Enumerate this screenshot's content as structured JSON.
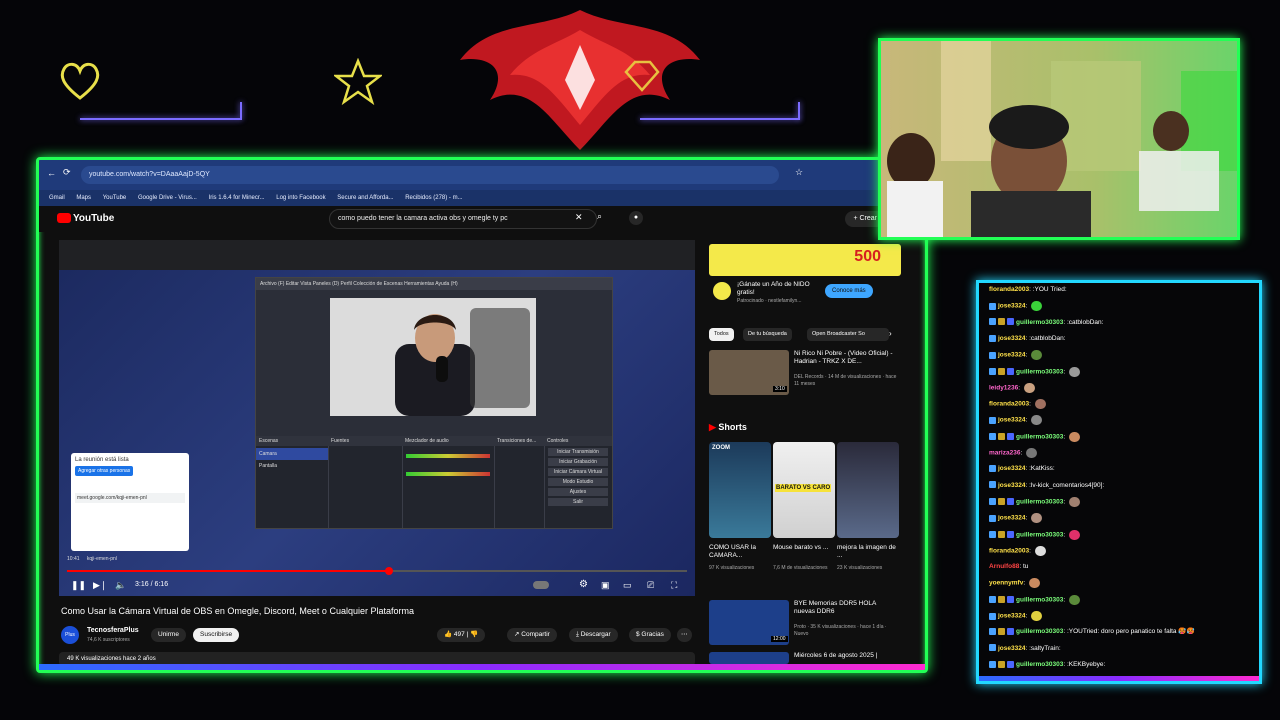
{
  "browser": {
    "url": "youtube.com/watch?v=DAaaAajD-5QY",
    "bookmarks": [
      "Gmail",
      "Maps",
      "YouTube",
      "Google Drive - Virus...",
      "Iris 1.6.4 for Minecr...",
      "Log into Facebook",
      "Secure and Afforda...",
      "Recibidos (278) - m..."
    ]
  },
  "youtube": {
    "logo": "YouTube",
    "search_query": "como puedo tener la camara activa obs y omegle ty pc",
    "create_label": "Crear",
    "video": {
      "time_current": "3:16",
      "time_total": "6:16",
      "progress": 0.52,
      "inner_clock": "10:41",
      "inner_meet_code": "kqji-emen-pnl",
      "meet_card_title": "La reunión está lista",
      "meet_card_button": "Agregar otras personas",
      "meet_card_link": "meet.google.com/kqji-emen-pnl",
      "obs_menu": "Archivo (F)   Editar   Vista   Paneles (D)   Perfil   Colección de Escenas   Herramientas   Ayuda (H)",
      "obs_docks": [
        "Escenas",
        "Fuentes",
        "Mezclador de audio",
        "Transiciones de...",
        "Controles"
      ],
      "obs_scenes": [
        "Camara",
        "Pantalla"
      ],
      "obs_controls": [
        "Iniciar Transmisión",
        "Iniciar Grabación",
        "Iniciar Cámara Virtual",
        "Modo Estudio",
        "Ajustes",
        "Salir"
      ]
    },
    "title": "Como Usar la Cámara Virtual de OBS en Omegle, Discord, Meet o Cualquier Plataforma",
    "channel_name": "TecnosferaPlus",
    "channel_avatar_text": "Plus",
    "channel_subs": "74,6 K suscriptores",
    "join_label": "Unirme",
    "subscribe_label": "Suscribirse",
    "likes": "497",
    "share_label": "Compartir",
    "download_label": "Descargar",
    "thanks_label": "Gracias",
    "desc_meta": "49 K visualizaciones  hace 2 años",
    "ad": {
      "number": "500",
      "title": "¡Gánate un Año de NIDO gratis!",
      "sponsored": "Patrocinado · nestlefamilyn...",
      "button": "Conoce más"
    },
    "chips": [
      "Todos",
      "De tu búsqueda",
      "Open Broadcaster So"
    ],
    "recommendations": [
      {
        "title": "Ni Rico Ni Pobre - (Video Oficial) - Hadrian - TRKZ X DE...",
        "meta": "DEL Records · 14 M de visualizaciones · hace 11 meses",
        "duration": "3:10"
      },
      {
        "title": "BYE Memorias DDR5 HOLA nuevas DDR6",
        "meta": "Proto · 35 K visualizaciones · hace 1 día · Nuevo",
        "duration": "12:00"
      },
      {
        "title": "Miércoles 6 de agosto 2025 |",
        "meta": "",
        "duration": ""
      }
    ],
    "shorts_label": "Shorts",
    "shorts": [
      {
        "title": "COMO USAR la CAMARA...",
        "views": "97 K visualizaciones",
        "overlay": "ZOOM"
      },
      {
        "title": "Mouse barato vs ...",
        "views": "7,6 M de visualizaciones",
        "overlay": "BARATO VS CARO"
      },
      {
        "title": "mejora la imagen de ...",
        "views": "23 K visualizaciones",
        "overlay": ""
      }
    ]
  },
  "chat": [
    {
      "user": "floranda2003",
      "text": ":YOU Tried:",
      "badges": 0,
      "color": "#ffe14a"
    },
    {
      "user": "jose3324",
      "text": "",
      "badges": 1,
      "color": "#ffe14a",
      "emote": "#3ad13a"
    },
    {
      "user": "guillermo30303",
      "text": ":catblobDan:",
      "badges": 3,
      "color": "#7cff7c"
    },
    {
      "user": "jose3324",
      "text": ":catblobDan:",
      "badges": 1,
      "color": "#ffe14a"
    },
    {
      "user": "jose3324",
      "text": "",
      "badges": 1,
      "color": "#ffe14a",
      "emote": "#5a8a3a"
    },
    {
      "user": "guillermo30303",
      "text": "",
      "badges": 3,
      "color": "#7cff7c",
      "emote": "#999"
    },
    {
      "user": "leidy1236",
      "text": "",
      "badges": 0,
      "color": "#ff66cc",
      "emote": "#c9a080"
    },
    {
      "user": "floranda2003",
      "text": "",
      "badges": 0,
      "color": "#ffe14a",
      "emote": "#a07060"
    },
    {
      "user": "jose3324",
      "text": "",
      "badges": 1,
      "color": "#ffe14a",
      "emote": "#888"
    },
    {
      "user": "guillermo30303",
      "text": "",
      "badges": 3,
      "color": "#7cff7c",
      "emote": "#c98a60"
    },
    {
      "user": "mariza236",
      "text": "",
      "badges": 0,
      "color": "#ff66cc",
      "emote": "#777"
    },
    {
      "user": "jose3324",
      "text": ":KatKiss:",
      "badges": 1,
      "color": "#ffe14a"
    },
    {
      "user": "jose3324",
      "text": ":lv-kick_comentarios4[90]:",
      "badges": 1,
      "color": "#ffe14a"
    },
    {
      "user": "guillermo30303",
      "text": "",
      "badges": 3,
      "color": "#7cff7c",
      "emote": "#a08070"
    },
    {
      "user": "jose3324",
      "text": "",
      "badges": 1,
      "color": "#ffe14a",
      "emote": "#b09080"
    },
    {
      "user": "guillermo30303",
      "text": "",
      "badges": 3,
      "color": "#7cff7c",
      "emote": "#e0306a"
    },
    {
      "user": "floranda2003",
      "text": "",
      "badges": 0,
      "color": "#ffe14a",
      "emote": "#ddd"
    },
    {
      "user": "Arnulfo88",
      "text": "tu",
      "badges": 0,
      "color": "#ff4444"
    },
    {
      "user": "yoennymfv",
      "text": "",
      "badges": 0,
      "color": "#ffe14a",
      "emote": "#c98a60"
    },
    {
      "user": "guillermo30303",
      "text": "",
      "badges": 3,
      "color": "#7cff7c",
      "emote": "#5a8a3a"
    },
    {
      "user": "jose3324",
      "text": "",
      "badges": 1,
      "color": "#ffe14a",
      "emote": "#e0d040"
    },
    {
      "user": "guillermo30303",
      "text": ":YOUTried: doro pero panatico te falta 🥵🥵",
      "badges": 3,
      "color": "#7cff7c"
    },
    {
      "user": "jose3324",
      "text": ":saltyTrain:",
      "badges": 1,
      "color": "#ffe14a"
    },
    {
      "user": "guillermo30303",
      "text": ":KEKByebye:",
      "badges": 3,
      "color": "#7cff7c"
    }
  ],
  "colors": {
    "frame_green": "#22ff55",
    "chat_border": "#22d8ff",
    "yt_red": "#ff0000"
  }
}
